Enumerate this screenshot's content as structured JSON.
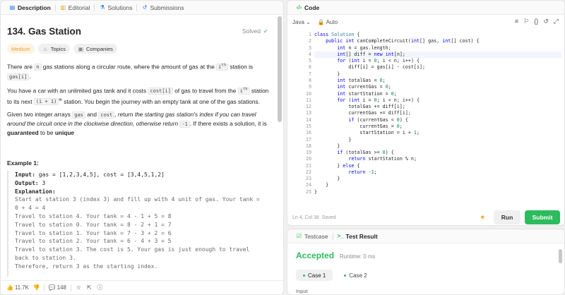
{
  "left_tabs": [
    {
      "label": "Description",
      "icon": "document-icon"
    },
    {
      "label": "Editorial",
      "icon": "book-icon"
    },
    {
      "label": "Solutions",
      "icon": "flask-icon"
    },
    {
      "label": "Submissions",
      "icon": "history-icon"
    }
  ],
  "problem": {
    "title": "134. Gas Station",
    "status": "Solved",
    "chips": [
      "Medium",
      "Topics",
      "Companies"
    ]
  },
  "desc": {
    "p1a": "There are ",
    "p1b": "n",
    "p1c": " gas stations along a circular route, where the amount of gas at the ",
    "p1d": "i",
    "p1e": "th",
    "p1f": " station is ",
    "p1g": "gas[i]",
    "p1h": ".",
    "p2a": "You have a car with an unlimited gas tank and it costs ",
    "p2b": "cost[i]",
    "p2c": " of gas to travel from the ",
    "p2d": "i",
    "p2e": "th",
    "p2f": " station to its next ",
    "p2g": "(i + 1)",
    "p2h": "th",
    "p2i": " station. You begin the journey with an empty tank at one of the gas stations.",
    "p3a": "Given two integer arrays ",
    "p3b": "gas",
    "p3c": " and ",
    "p3d": "cost",
    "p3e": ", return ",
    "p3f": "the starting gas station's index if you can travel around the circuit once in the clockwise direction, otherwise return ",
    "p3g": "-1",
    "p3h": ". If there exists a solution, it is ",
    "p3i": "guaranteed",
    "p3j": " to be ",
    "p3k": "unique"
  },
  "example": {
    "title": "Example 1:",
    "input_label": "Input:",
    "input_value": " gas = [1,2,3,4,5], cost = [3,4,5,1,2]",
    "output_label": "Output:",
    "output_value": " 3",
    "expl_label": "Explanation:",
    "lines": [
      "Start at station 3 (index 3) and fill up with 4 unit of gas. Your tank =",
      "0 + 4 = 4",
      "Travel to station 4. Your tank = 4 - 1 + 5 = 8",
      "Travel to station 0. Your tank = 8 - 2 + 1 = 7",
      "Travel to station 1. Your tank = 7 - 3 + 2 = 6",
      "Travel to station 2. Your tank = 6 - 4 + 3 = 5",
      "Travel to station 3. The cost is 5. Your gas is just enough to travel",
      "back to station 3.",
      "Therefore, return 3 as the starting index."
    ]
  },
  "footer": {
    "likes": "11.7K",
    "comments": "148"
  },
  "editor": {
    "tab": "Code",
    "language": "Java",
    "mode": "Auto",
    "status_pos": "Ln 4, Col 38",
    "status_saved": "Saved",
    "run_label": "Run",
    "submit_label": "Submit",
    "code": [
      "class Solution {",
      "    public int canCompleteCircuit(int[] gas, int[] cost) {",
      "        int n = gas.length;",
      "        int[] diff = new int[n];",
      "        for (int i = 0; i < n; i++) {",
      "            diff[i] = gas[i] - cost[i];",
      "        }",
      "        int totalGas = 0;",
      "        int currentGas = 0;",
      "        int startStation = 0;",
      "        for (int i = 0; i < n; i++) {",
      "            totalGas += diff[i];",
      "            currentGas += diff[i];",
      "            if (currentGas < 0) {",
      "                currentGas = 0;",
      "                startStation = i + 1;",
      "            }",
      "        }",
      "        if (totalGas >= 0) {",
      "            return startStation % n;",
      "        } else {",
      "            return -1;",
      "        }",
      "    }",
      "}"
    ]
  },
  "result": {
    "tab1": "Testcase",
    "tab2": "Test Result",
    "status": "Accepted",
    "runtime": "Runtime: 0 ms",
    "cases": [
      "Case 1",
      "Case 2"
    ],
    "input_label": "Input"
  }
}
